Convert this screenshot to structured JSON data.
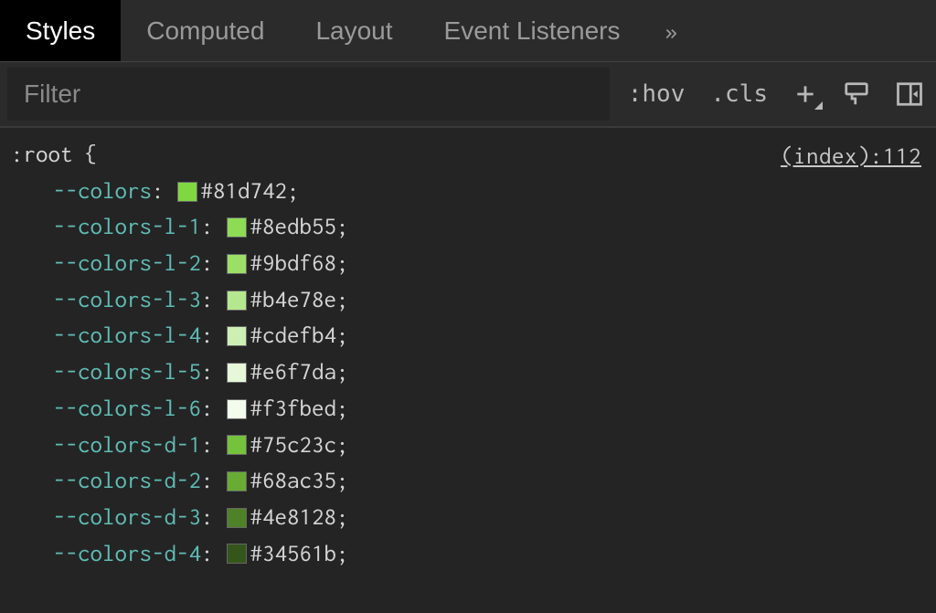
{
  "tabs": {
    "items": [
      {
        "label": "Styles",
        "active": true
      },
      {
        "label": "Computed",
        "active": false
      },
      {
        "label": "Layout",
        "active": false
      },
      {
        "label": "Event Listeners",
        "active": false
      }
    ],
    "more": "»"
  },
  "toolbar": {
    "filter_placeholder": "Filter",
    "hov": ":hov",
    "cls": ".cls",
    "plus": "+"
  },
  "rule": {
    "selector": ":root",
    "open_brace": " {",
    "source_link": "(index):112",
    "properties": [
      {
        "name": "--colors",
        "value": "#81d742",
        "swatch": "#81d742"
      },
      {
        "name": "--colors-l-1",
        "value": "#8edb55",
        "swatch": "#8edb55"
      },
      {
        "name": "--colors-l-2",
        "value": "#9bdf68",
        "swatch": "#9bdf68"
      },
      {
        "name": "--colors-l-3",
        "value": "#b4e78e",
        "swatch": "#b4e78e"
      },
      {
        "name": "--colors-l-4",
        "value": "#cdefb4",
        "swatch": "#cdefb4"
      },
      {
        "name": "--colors-l-5",
        "value": "#e6f7da",
        "swatch": "#e6f7da"
      },
      {
        "name": "--colors-l-6",
        "value": "#f3fbed",
        "swatch": "#f3fbed"
      },
      {
        "name": "--colors-d-1",
        "value": "#75c23c",
        "swatch": "#75c23c"
      },
      {
        "name": "--colors-d-2",
        "value": "#68ac35",
        "swatch": "#68ac35"
      },
      {
        "name": "--colors-d-3",
        "value": "#4e8128",
        "swatch": "#4e8128"
      },
      {
        "name": "--colors-d-4",
        "value": "#34561b",
        "swatch": "#34561b"
      }
    ]
  }
}
